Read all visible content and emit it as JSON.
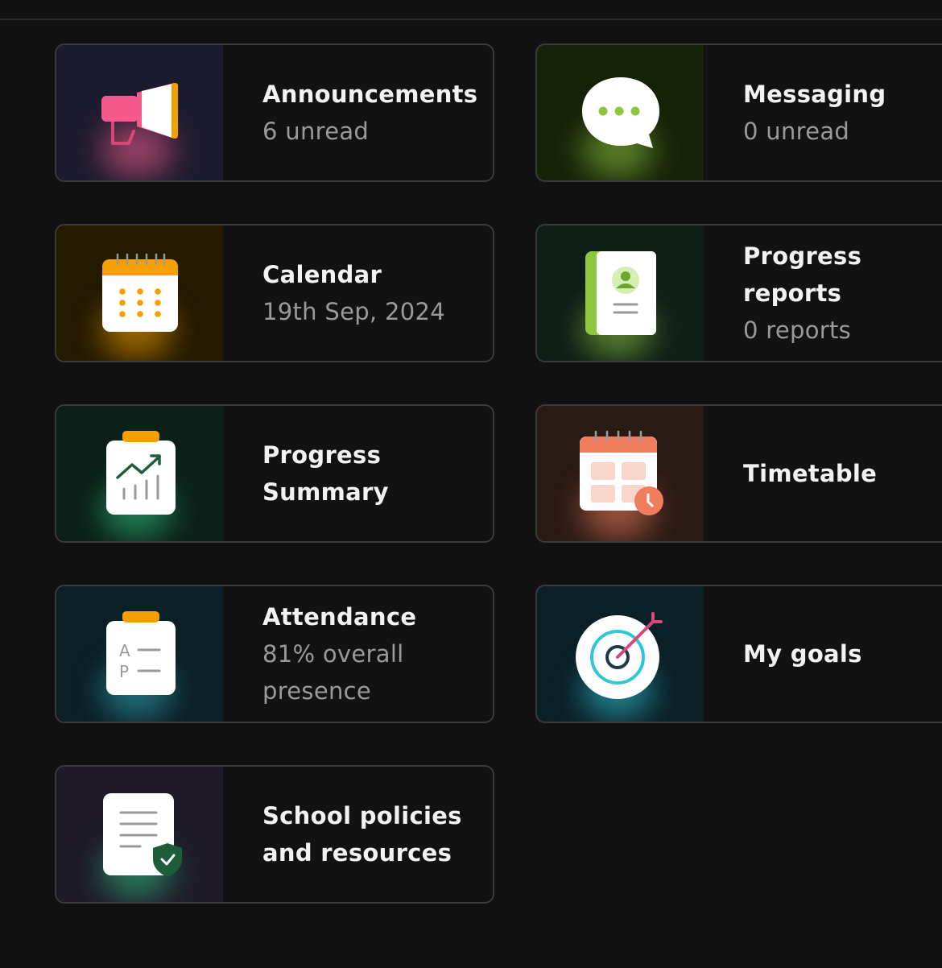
{
  "cards": [
    {
      "title": "Announcements",
      "subtitle": "6 unread",
      "icon": "megaphone-icon"
    },
    {
      "title": "Messaging",
      "subtitle": "0 unread",
      "icon": "chat-bubble-icon"
    },
    {
      "title": "Calendar",
      "subtitle": "19th Sep, 2024",
      "icon": "calendar-icon"
    },
    {
      "title_line1": "Progress",
      "title_line2": "reports",
      "subtitle": "0 reports",
      "icon": "report-book-icon"
    },
    {
      "title_line1": "Progress",
      "title_line2": "Summary",
      "icon": "chart-clipboard-icon"
    },
    {
      "title": "Timetable",
      "icon": "timetable-icon"
    },
    {
      "title": "Attendance",
      "subtitle_line1": "81% overall",
      "subtitle_line2": "presence",
      "icon": "attendance-clipboard-icon"
    },
    {
      "title": "My goals",
      "icon": "target-icon"
    },
    {
      "title_line1": "School policies",
      "title_line2": "and resources",
      "icon": "policy-document-icon"
    }
  ],
  "colors": {
    "background": "#111111",
    "card_border": "#3a3a3a",
    "title": "#f2f2f2",
    "subtitle": "#9a9a9a",
    "accent_pink": "#f45b8c",
    "accent_orange": "#f5a000",
    "accent_green": "#8dc63f",
    "accent_coral": "#f07e5e",
    "accent_teal": "#2fc7d8"
  }
}
